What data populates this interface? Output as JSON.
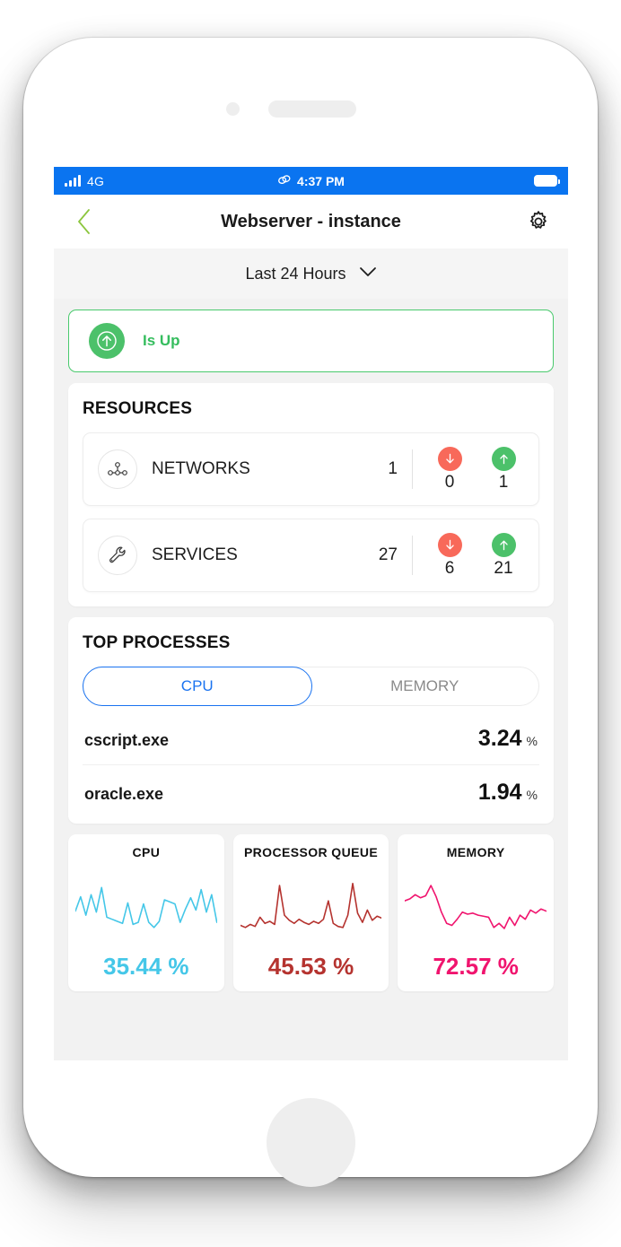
{
  "statusbar": {
    "network_icon": "signal-bars-icon",
    "network_label": "4G",
    "link_icon": "link-loop-icon",
    "time": "4:37 PM",
    "battery_icon": "battery-icon"
  },
  "navbar": {
    "back_icon": "chevron-left-icon",
    "title": "Webserver - instance",
    "settings_icon": "gear-icon"
  },
  "time_range": {
    "label": "Last 24 Hours",
    "chevron_icon": "chevron-down-icon"
  },
  "status_banner": {
    "icon": "arrow-up-circle-icon",
    "text": "Is Up",
    "color": "#35bd5e"
  },
  "resources": {
    "title": "RESOURCES",
    "rows": [
      {
        "icon": "network-topology-icon",
        "name": "NETWORKS",
        "total": "1",
        "down_icon": "arrow-down-circle-icon",
        "down_value": "0",
        "up_icon": "arrow-up-circle-icon",
        "up_value": "1"
      },
      {
        "icon": "wrench-icon",
        "name": "SERVICES",
        "total": "27",
        "down_icon": "arrow-down-circle-icon",
        "down_value": "6",
        "up_icon": "arrow-up-circle-icon",
        "up_value": "21"
      }
    ]
  },
  "top_processes": {
    "title": "TOP PROCESSES",
    "tabs": [
      {
        "label": "CPU",
        "active": true
      },
      {
        "label": "MEMORY",
        "active": false
      }
    ],
    "rows": [
      {
        "name": "cscript.exe",
        "value": "3.24",
        "unit": "%"
      },
      {
        "name": "oracle.exe",
        "value": "1.94",
        "unit": "%"
      }
    ]
  },
  "metrics": [
    {
      "title": "CPU",
      "value": "35.44 %",
      "color": "#45c7e8"
    },
    {
      "title": "PROCESSOR QUEUE",
      "value": "45.53 %",
      "color": "#b5332f"
    },
    {
      "title": "MEMORY",
      "value": "72.57 %",
      "color": "#f0146e"
    }
  ],
  "chart_data": [
    {
      "type": "line",
      "title": "CPU",
      "color": "#45c7e8",
      "ylabel": "%",
      "ylim": [
        0,
        100
      ],
      "values": [
        42,
        70,
        34,
        74,
        40,
        88,
        30,
        26,
        22,
        18,
        58,
        16,
        20,
        56,
        20,
        10,
        22,
        64,
        60,
        56,
        20,
        46,
        68,
        44,
        84,
        40,
        74,
        20
      ],
      "summary_value": 35.44
    },
    {
      "type": "line",
      "title": "PROCESSOR QUEUE",
      "color": "#b5332f",
      "ylabel": "%",
      "ylim": [
        0,
        100
      ],
      "values": [
        14,
        10,
        16,
        12,
        30,
        18,
        22,
        16,
        92,
        34,
        24,
        18,
        26,
        20,
        16,
        22,
        18,
        26,
        62,
        18,
        12,
        10,
        34,
        96,
        38,
        20,
        44,
        24,
        32,
        28
      ],
      "summary_value": 45.53
    },
    {
      "type": "line",
      "title": "MEMORY",
      "color": "#f0146e",
      "ylabel": "%",
      "ylim": [
        0,
        100
      ],
      "values": [
        62,
        66,
        74,
        68,
        72,
        92,
        70,
        40,
        18,
        14,
        26,
        40,
        36,
        38,
        34,
        32,
        30,
        10,
        18,
        8,
        30,
        14,
        34,
        26,
        44,
        38,
        46,
        42
      ],
      "summary_value": 72.57
    }
  ]
}
